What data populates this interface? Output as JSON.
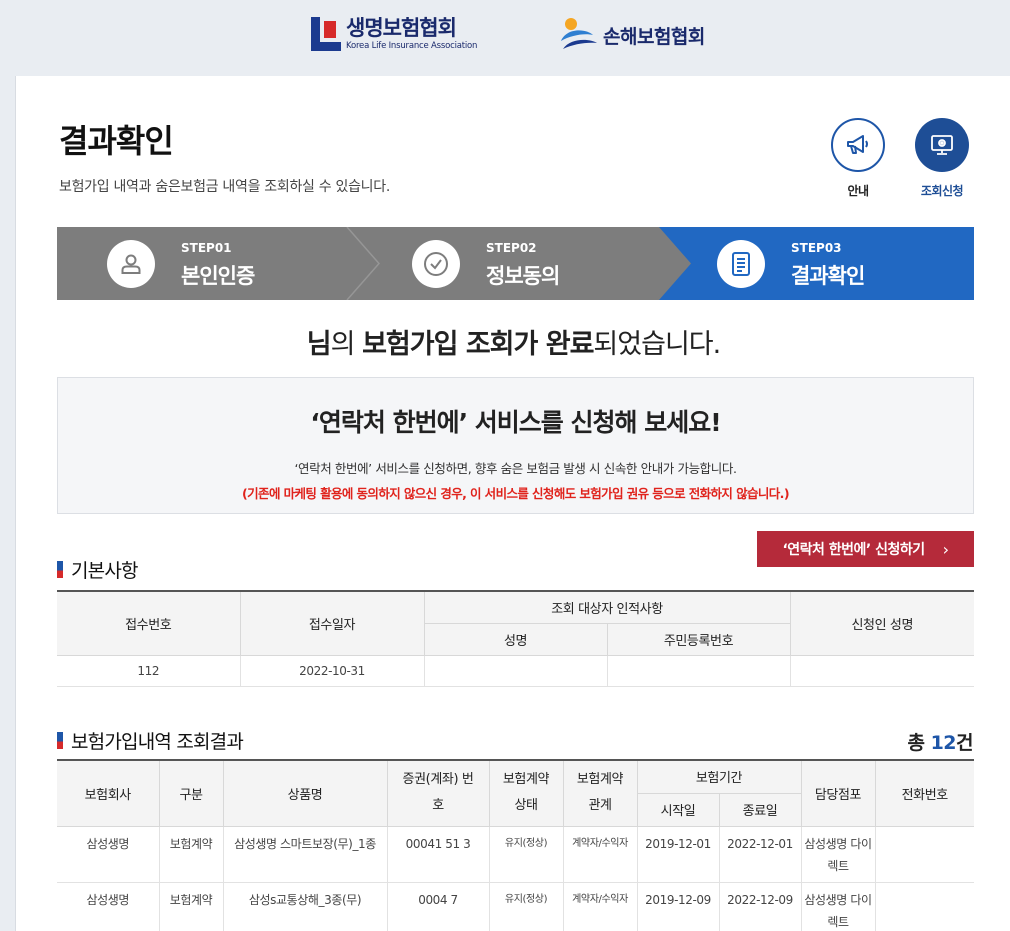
{
  "header": {
    "logo1_ko": "생명보험협회",
    "logo1_en": "Korea Life Insurance Association",
    "logo2_ko": "손해보험협회"
  },
  "page": {
    "title": "결과확인",
    "desc": "보험가입 내역과 숨은보험금 내역을 조회하실 수 있습니다."
  },
  "top_buttons": {
    "guide": "안내",
    "request": "조회신청"
  },
  "steps": [
    {
      "num": "STEP01",
      "name": "본인인증"
    },
    {
      "num": "STEP02",
      "name": "정보동의"
    },
    {
      "num": "STEP03",
      "name": "결과확인"
    }
  ],
  "done": {
    "name_tail": "님",
    "part1": "의 ",
    "bold": "보험가입 조회가 완료",
    "part2": "되었습니다."
  },
  "promo": {
    "title": "‘연락처 한번에’ 서비스를 신청해 보세요!",
    "desc": "‘연락처 한번에’ 서비스를 신청하면, 향후 숨은 보험금 발생 시 신속한 안내가 가능합니다.",
    "warn": "(기존에 마케팅 활용에 동의하지 않으신 경우, 이 서비스를 신청해도 보험가입 권유 등으로 전화하지 않습니다.)"
  },
  "apply_button": {
    "label": "‘연락처 한번에’ 신청하기",
    "arrow": "›"
  },
  "basic": {
    "title": "기본사항",
    "headers": {
      "receipt_no": "접수번호",
      "receipt_date": "접수일자",
      "target_group": "조회 대상자 인적사항",
      "name": "성명",
      "resident_no": "주민등록번호",
      "applicant": "신청인 성명"
    },
    "row": {
      "receipt_no": "112",
      "receipt_date": "2022-10-31",
      "name": "",
      "resident_no": "",
      "applicant": ""
    }
  },
  "results": {
    "title": "보험가입내역 조회결과",
    "total_prefix": "총 ",
    "total_count": "12",
    "total_suffix": "건",
    "headers": {
      "company": "보험회사",
      "type": "구분",
      "product": "상품명",
      "policy_no": "증권(계좌) 번호",
      "status": "보험계약 상태",
      "relation": "보험계약 관계",
      "period": "보험기간",
      "start": "시작일",
      "end": "종료일",
      "branch": "담당점포",
      "phone": "전화번호"
    },
    "rows": [
      {
        "company": "삼성생명",
        "type": "보험계약",
        "product": "삼성생명 스마트보장(무)_1종",
        "policy_no": "00041   51 3",
        "status": "유지(정상)",
        "relation": "계약자/수익자",
        "start": "2019-12-01",
        "end": "2022-12-01",
        "branch": "삼성생명 다이렉트",
        "phone": ""
      },
      {
        "company": "삼성생명",
        "type": "보험계약",
        "product": "삼성s교통상해_3종(무)",
        "policy_no": "0004 7",
        "status": "유지(정상)",
        "relation": "계약자/수익자",
        "start": "2019-12-09",
        "end": "2022-12-09",
        "branch": "삼성생명 다이렉트",
        "phone": ""
      }
    ]
  }
}
